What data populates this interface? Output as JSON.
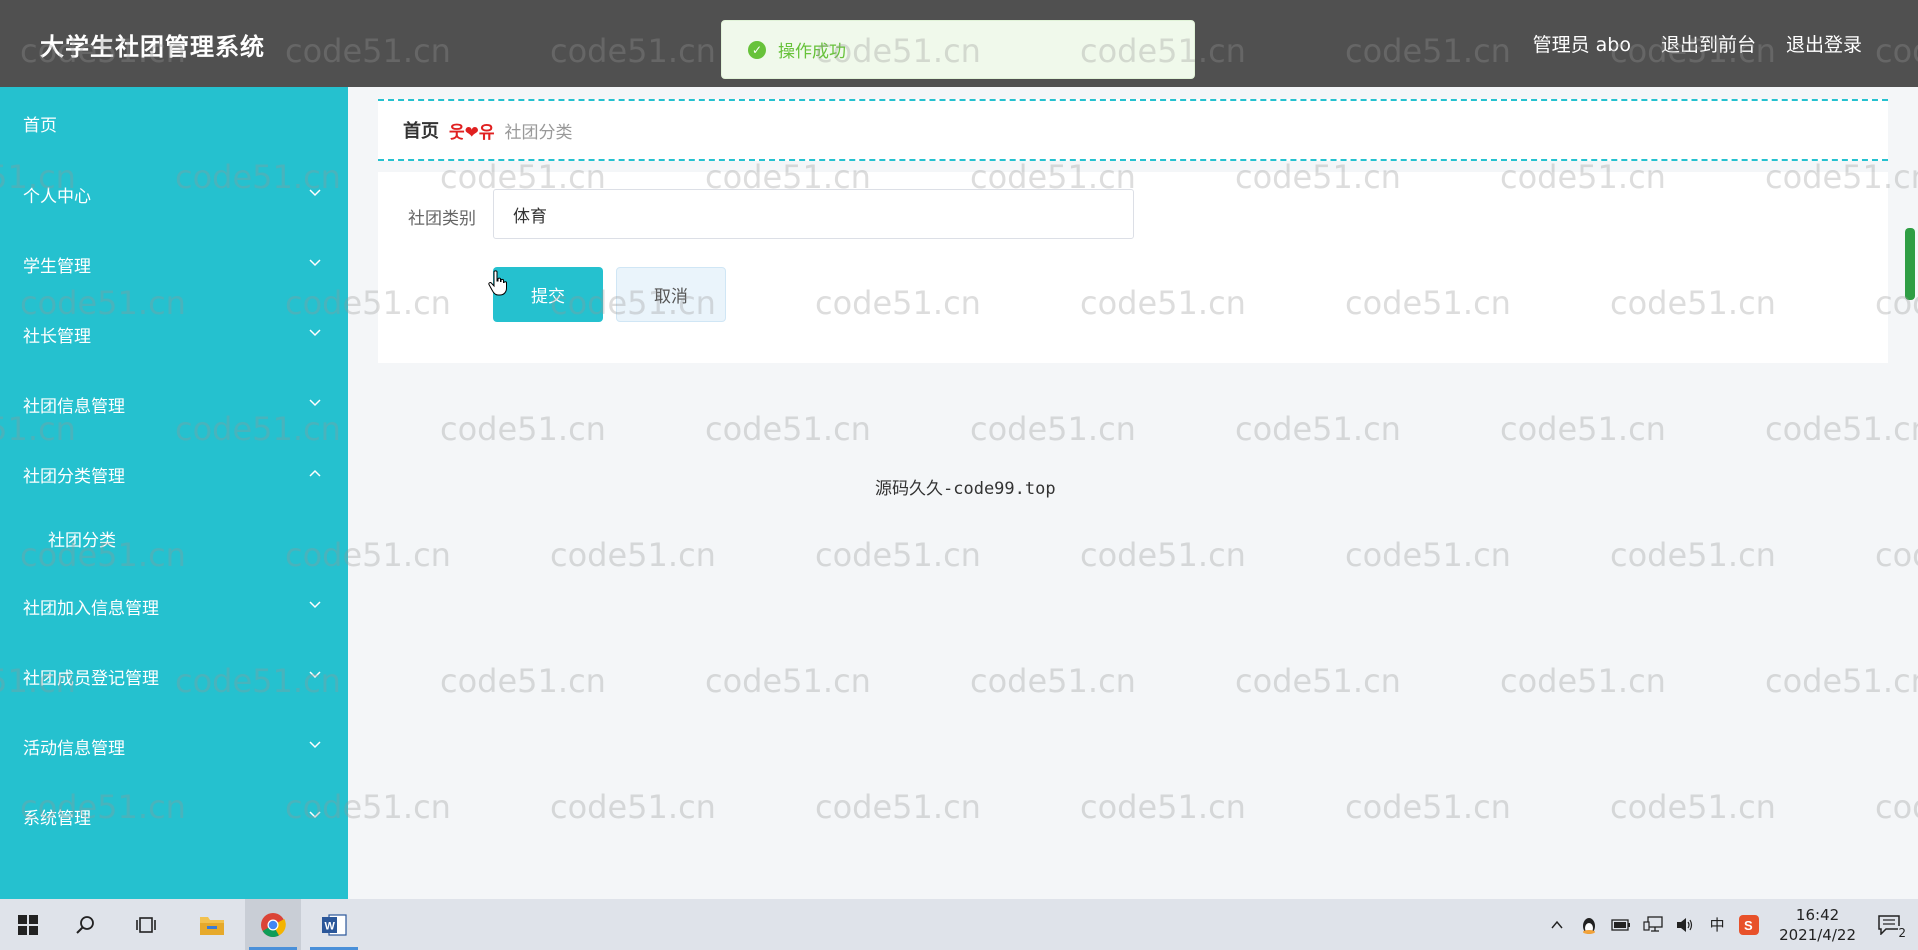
{
  "header": {
    "app_title": "大学生社团管理系统",
    "user_label": "管理员 abo",
    "goto_front": "退出到前台",
    "logout": "退出登录"
  },
  "toast": {
    "message": "操作成功",
    "icon": "success-check-icon"
  },
  "sidebar": {
    "items": [
      {
        "label": "首页",
        "chevron": "none"
      },
      {
        "label": "个人中心",
        "chevron": "down"
      },
      {
        "label": "学生管理",
        "chevron": "down"
      },
      {
        "label": "社长管理",
        "chevron": "down"
      },
      {
        "label": "社团信息管理",
        "chevron": "down"
      },
      {
        "label": "社团分类管理",
        "chevron": "up"
      },
      {
        "label": "社团分类",
        "chevron": "none"
      },
      {
        "label": "社团加入信息管理",
        "chevron": "down"
      },
      {
        "label": "社团成员登记管理",
        "chevron": "down"
      },
      {
        "label": "活动信息管理",
        "chevron": "down"
      },
      {
        "label": "系统管理",
        "chevron": "down"
      }
    ]
  },
  "breadcrumb": {
    "home": "首页",
    "separator": "웃❤유",
    "current": "社团分类"
  },
  "form": {
    "category_label": "社团类别",
    "category_value": "体育",
    "submit_label": "提交",
    "cancel_label": "取消"
  },
  "footer": {
    "text": "源码久久-code99.top"
  },
  "watermark": {
    "text": "code51.cn"
  },
  "taskbar": {
    "ime": "中",
    "time": "16:42",
    "date": "2021/4/22",
    "notification_count": "2"
  },
  "colors": {
    "accent": "#25c1cf",
    "header_bg": "#505050",
    "success": "#67c23a"
  }
}
